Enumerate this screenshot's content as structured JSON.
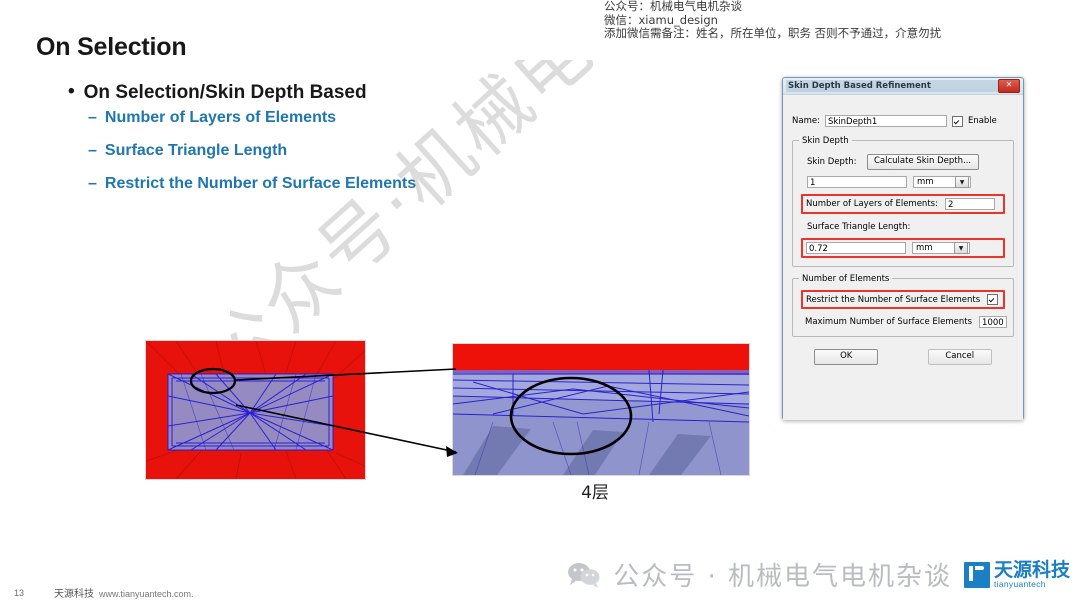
{
  "top_note": {
    "lines": [
      "公众号：机械电气电机杂谈",
      "微信：xiamu_design",
      "添加微信需备注：姓名，所在单位，职务 否则不予通过，介意勿扰"
    ]
  },
  "slide": {
    "title": "On Selection",
    "bullet_marker": "•",
    "bullet": "On Selection/Skin Depth Based",
    "sub_marker": "–",
    "sub_bullets": [
      "Number of Layers of Elements",
      "Surface Triangle Length",
      "Restrict the Number of Surface Elements"
    ],
    "mesh_caption": "4层"
  },
  "watermark": {
    "text": "公众号·机械电气电机杂谈"
  },
  "dialog": {
    "title": "Skin Depth Based Refinement",
    "close_glyph": "✕",
    "name_label": "Name:",
    "name_value": "SkinDepth1",
    "enable_label": "Enable",
    "skin_depth_group": "Skin Depth",
    "skin_depth_label": "Skin Depth:",
    "calculate_button": "Calculate Skin Depth...",
    "skin_depth_value": "1",
    "skin_depth_unit": "mm",
    "layers_label": "Number of Layers of Elements:",
    "layers_value": "2",
    "triangle_label": "Surface Triangle Length:",
    "triangle_value": "0.72",
    "triangle_unit": "mm",
    "elements_group": "Number of Elements",
    "restrict_label": "Restrict the Number of Surface Elements",
    "max_elements_label": "Maximum Number of Surface Elements",
    "max_elements_value": "1000",
    "ok_button": "OK",
    "cancel_button": "Cancel",
    "dropdown_glyph": "▼",
    "highlight_color": "#e8342a"
  },
  "footer": {
    "page_number": "13",
    "company": "天源科技",
    "url": "www.tianyuantech.com."
  },
  "brand": {
    "wechat_text": "公众号 · 机械电气电机杂谈",
    "logo_cn": "天源科技",
    "logo_en": "tianyuantech"
  }
}
